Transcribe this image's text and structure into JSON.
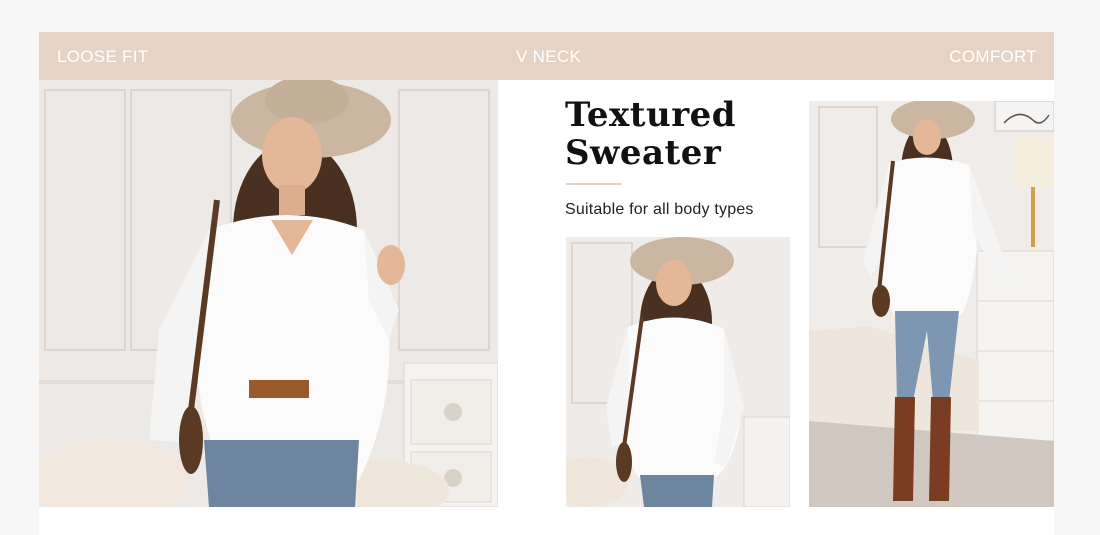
{
  "features": [
    "LOOSE FIT",
    "V NECK",
    "COMFORT"
  ],
  "product": {
    "title_line1": "Textured",
    "title_line2": "Sweater",
    "subtitle": "Suitable for all body types"
  },
  "colors": {
    "banner": "#e5d3c5",
    "page_background": "#f7f7f7",
    "card": "#ffffff",
    "title_text": "#111111"
  }
}
